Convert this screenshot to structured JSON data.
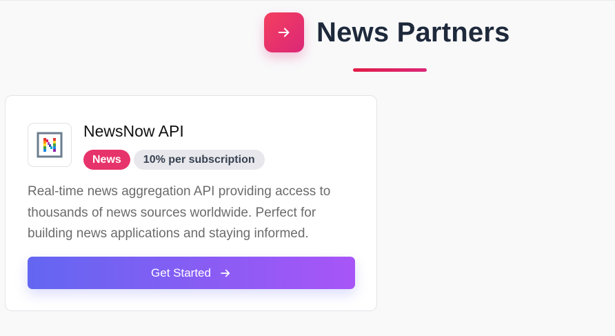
{
  "header": {
    "title": "News Partners",
    "icon": "arrow-right-icon",
    "accent_gradient": [
      "#f43f5e",
      "#db2777"
    ]
  },
  "partners": [
    {
      "name": "NewsNow API",
      "logo_icon": "newsnow-logo",
      "category": "News",
      "commission": "10% per subscription",
      "description": "Real-time news aggregation API providing access to thousands of news sources worldwide. Perfect for building news applications and staying informed.",
      "cta_label": "Get Started",
      "cta_icon": "arrow-right-icon",
      "cta_gradient": [
        "#6366f1",
        "#a855f7"
      ],
      "category_color": "#e7336b"
    }
  ]
}
